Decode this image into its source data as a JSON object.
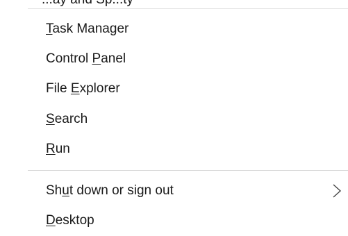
{
  "clipped_top_text": "...ay and Sp...ty",
  "menu": {
    "items": [
      {
        "before": "",
        "accel": "T",
        "after": "ask Manager"
      },
      {
        "before": "Control ",
        "accel": "P",
        "after": "anel"
      },
      {
        "before": "File ",
        "accel": "E",
        "after": "xplorer"
      },
      {
        "before": "",
        "accel": "S",
        "after": "earch"
      },
      {
        "before": "",
        "accel": "R",
        "after": "un"
      },
      {
        "before": "Sh",
        "accel": "u",
        "after": "t down or sign out"
      },
      {
        "before": "",
        "accel": "D",
        "after": "esktop"
      }
    ]
  },
  "icons": {
    "submenu_arrow": "chevron-right-icon"
  }
}
